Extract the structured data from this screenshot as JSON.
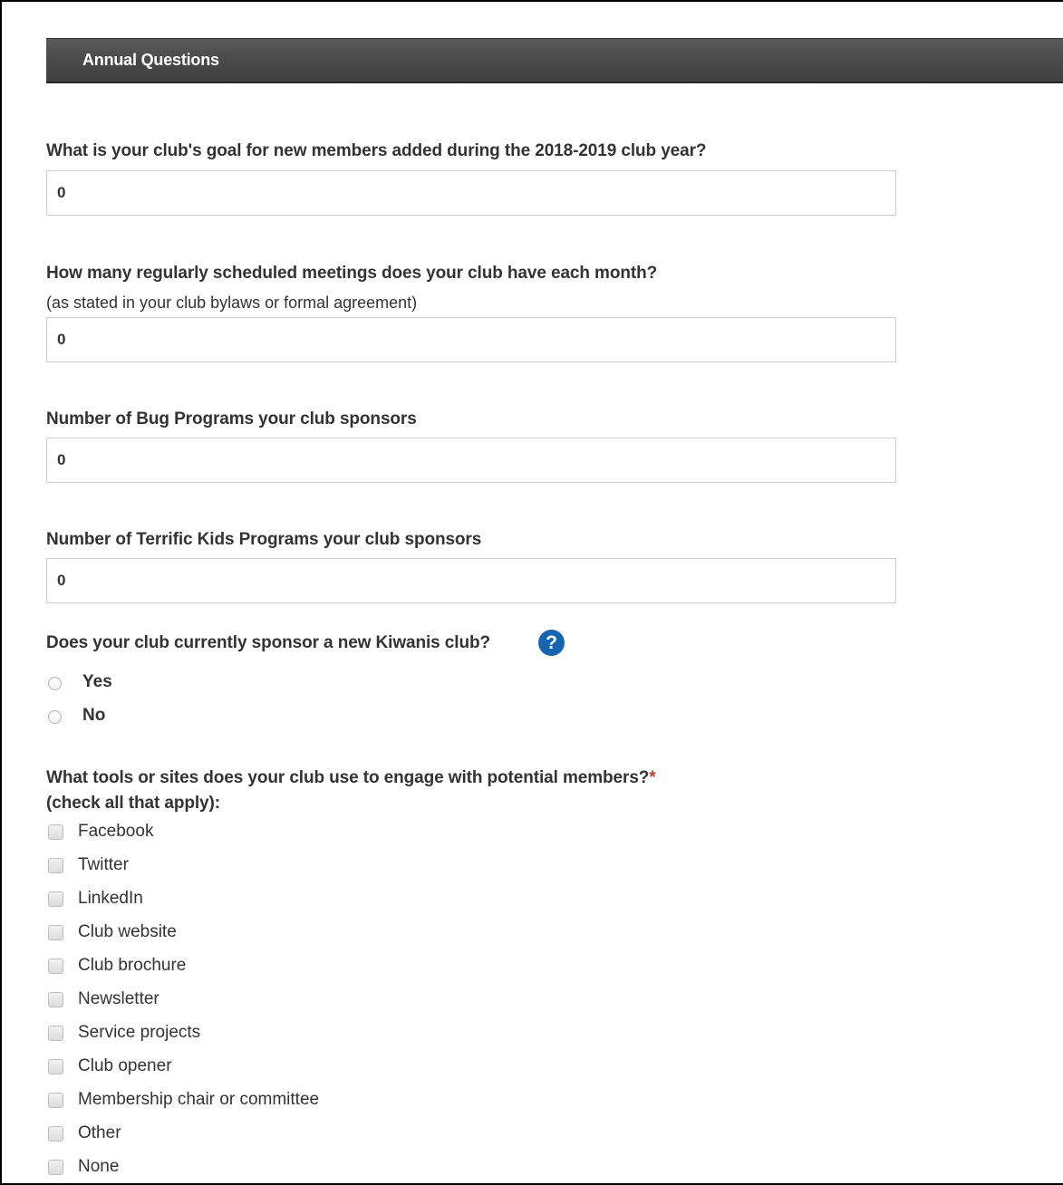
{
  "section": {
    "title": "Annual Questions"
  },
  "questions": {
    "goal": {
      "label": "What is your club's goal for new members added during the 2018-2019 club year?",
      "value": "0"
    },
    "meetings": {
      "label": "How many regularly scheduled meetings does your club have each month?",
      "note": "(as stated in your club bylaws or formal agreement)",
      "value": "0"
    },
    "bug": {
      "label": "Number of Bug Programs your club sponsors",
      "value": "0"
    },
    "terrific_kids": {
      "label": "Number of Terrific Kids Programs your club sponsors",
      "value": "0"
    },
    "sponsor_new_club": {
      "label": "Does your club currently sponsor a new Kiwanis club?",
      "help_icon": "question-circle-icon",
      "help_glyph": "?",
      "options": [
        "Yes",
        "No"
      ]
    },
    "tools": {
      "label": "What tools or sites does your club use to engage with potential members?",
      "required_mark": "*",
      "note": "(check all that apply):",
      "options": [
        "Facebook",
        "Twitter",
        "LinkedIn",
        "Club website",
        "Club brochure",
        "Newsletter",
        "Service projects",
        "Club opener",
        "Membership chair or committee",
        "Other",
        "None"
      ]
    }
  },
  "colors": {
    "header_bg": "#4a4a4a",
    "help_icon": "#1565b0",
    "required": "#c0392b",
    "text": "#333333"
  }
}
